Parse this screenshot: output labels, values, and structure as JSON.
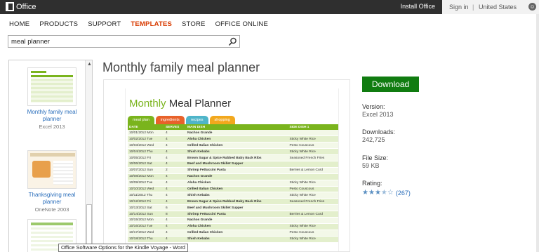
{
  "topbar": {
    "brand": "Office",
    "install": "Install Office",
    "signin": "Sign in",
    "separator": "|",
    "country": "United States",
    "smiley": "☺"
  },
  "nav": {
    "items": [
      "HOME",
      "PRODUCTS",
      "SUPPORT",
      "TEMPLATES",
      "STORE",
      "OFFICE ONLINE"
    ],
    "active_index": 3
  },
  "search": {
    "value": "meal planner",
    "icon": "search-icon"
  },
  "rail": {
    "cards": [
      {
        "title": "Monthly family meal planner",
        "app": "Excel 2013"
      },
      {
        "title": "Thanksgiving meal planner",
        "app": "OneNote 2003"
      }
    ]
  },
  "main": {
    "title": "Monthly family meal planner",
    "doc": {
      "title_accent": "Monthly",
      "title_rest": " Meal Planner",
      "tabs": [
        {
          "label": "meal plan",
          "color": "#7ab41d"
        },
        {
          "label": "ingredients",
          "color": "#e8622a"
        },
        {
          "label": "recipes",
          "color": "#4fb5c9"
        },
        {
          "label": "shopping",
          "color": "#f2a81d"
        }
      ],
      "headers": [
        "DATE",
        "SERVES",
        "MAIN DISH",
        "SIDE DISH 1"
      ],
      "rows": [
        [
          "10/01/2012 Mon",
          "4",
          "Nachos Grande",
          ""
        ],
        [
          "10/02/2012 Tue",
          "4",
          "Aloha Chicken",
          "Sticky White Rice"
        ],
        [
          "10/03/2012 Wed",
          "4",
          "Grilled Italian Chicken",
          "Pesto Couscous"
        ],
        [
          "10/04/2012 Thu",
          "4",
          "Shish Kebabs",
          "Sticky White Rice"
        ],
        [
          "10/05/2012 Fri",
          "4",
          "Brown Sugar & Spice Rubbed Baby Back Ribs",
          "Seasoned French Fries"
        ],
        [
          "10/06/2012 Sat",
          "4",
          "Beef and Mushroom Skillet Supper",
          ""
        ],
        [
          "10/07/2012 Sun",
          "2",
          "Shrimp Fettuccini Pasta",
          "Berries & Lemon Curd"
        ],
        [
          "10/08/2012 Mon",
          "4",
          "Nachos Grande",
          ""
        ],
        [
          "10/09/2012 Tue",
          "4",
          "Aloha Chicken",
          "Sticky White Rice"
        ],
        [
          "10/10/2012 Wed",
          "4",
          "Grilled Italian Chicken",
          "Pesto Couscous"
        ],
        [
          "10/11/2012 Thu",
          "4",
          "Shish Kebabs",
          "Sticky White Rice"
        ],
        [
          "10/12/2012 Fri",
          "4",
          "Brown Sugar & Spice Rubbed Baby Back Ribs",
          "Seasoned French Fries"
        ],
        [
          "10/13/2012 Sat",
          "6",
          "Beef and Mushroom Skillet Supper",
          ""
        ],
        [
          "10/14/2012 Sun",
          "8",
          "Shrimp Fettuccini Pasta",
          "Berries & Lemon Curd"
        ],
        [
          "10/15/2012 Mon",
          "4",
          "Nachos Grande",
          ""
        ],
        [
          "10/16/2012 Tue",
          "4",
          "Aloha Chicken",
          "Sticky White Rice"
        ],
        [
          "10/17/2012 Wed",
          "4",
          "Grilled Italian Chicken",
          "Pesto Couscous"
        ],
        [
          "10/18/2012 Thu",
          "4",
          "Shish Kebabs",
          "Sticky White Rice"
        ]
      ]
    }
  },
  "details": {
    "download": "Download",
    "version_label": "Version:",
    "version": "Excel 2013",
    "downloads_label": "Downloads:",
    "downloads": "242,725",
    "filesize_label": "File Size:",
    "filesize": "59 KB",
    "rating_label": "Rating:",
    "rating_stars": 3.5,
    "rating_count": "(267)"
  },
  "tooltip": "Office Software Options for the Kindle Voyage - Word",
  "colors": {
    "accent": "#d83b01",
    "download": "#107c10",
    "link": "#2a6ebb",
    "sheet_green": "#7ab41d"
  }
}
